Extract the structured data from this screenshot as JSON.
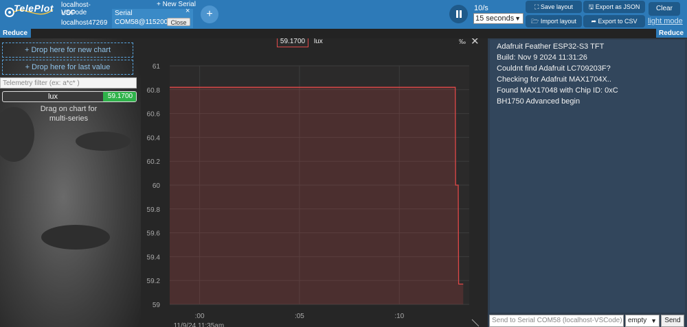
{
  "app": {
    "logo_text": "TelePlot"
  },
  "connections": {
    "name": "localhost-VSCode",
    "udp_label": "UDP",
    "udp_host": "localhost47269",
    "serial_label": "Serial",
    "serial_port": "COM58@115200",
    "close_label": "Close",
    "new_serial_label": "+ New Serial",
    "remove_icon": "×",
    "add_icon": "+"
  },
  "toolbar": {
    "rate": "10/s",
    "time_window": "15 seconds",
    "save_layout": "⛶ Save layout",
    "import_layout": "🗁 Import layout",
    "export_json": "🖫 Export as JSON",
    "export_csv": "➦ Export to CSV",
    "clear": "Clear",
    "light_mode": "light mode"
  },
  "left_panel": {
    "reduce_label": "Reduce",
    "drop_new_chart": "+ Drop here for new chart",
    "drop_last_value": "+ Drop here for last value",
    "filter_placeholder": "Telemetry filter (ex: a*c* )",
    "telemetry": [
      {
        "name": "lux",
        "value": "59.1700"
      }
    ],
    "drag_hint_line1": "Drag on chart for",
    "drag_hint_line2": "multi-series"
  },
  "chart": {
    "current_value": "59.1700",
    "series_name": "lux",
    "permille_icon": "‰",
    "close_icon": "✕",
    "date_label": "11/9/24 11:35am"
  },
  "chart_data": {
    "type": "area",
    "series": [
      {
        "name": "lux",
        "color": "#e04848",
        "x": [
          0,
          14.3,
          14.32,
          14.45,
          14.47,
          14.6,
          14.7
        ],
        "y": [
          60.82,
          60.82,
          60.0,
          60.0,
          59.17,
          59.17,
          59.17
        ]
      }
    ],
    "x_tick_labels": [
      ":00",
      ":05",
      ":10"
    ],
    "x_tick_values": [
      1.5,
      6.5,
      11.5
    ],
    "xlim": [
      0,
      15
    ],
    "ylim": [
      59,
      61
    ],
    "y_ticks": [
      61,
      60.8,
      60.6,
      60.4,
      60.2,
      60,
      59.8,
      59.6,
      59.4,
      59.2,
      59
    ],
    "grid": true
  },
  "right_panel": {
    "reduce_label": "Reduce",
    "console_lines": [
      "Adafruit Feather ESP32-S3 TFT",
      "Build: Nov 9 2024 11:31:26",
      "Couldnt find Adafruit LC709203F?",
      "Checking for Adafruit MAX1704X..",
      "Found MAX17048 with Chip ID: 0xC",
      "BH1750 Advanced begin"
    ],
    "send_placeholder": "Send to Serial COM58 (localhost-VSCode)",
    "line_ending": "empty",
    "send_label": "Send"
  },
  "colors": {
    "accent": "#2d7ab8",
    "series": "#e04848",
    "value_badge": "#2fb24a"
  }
}
